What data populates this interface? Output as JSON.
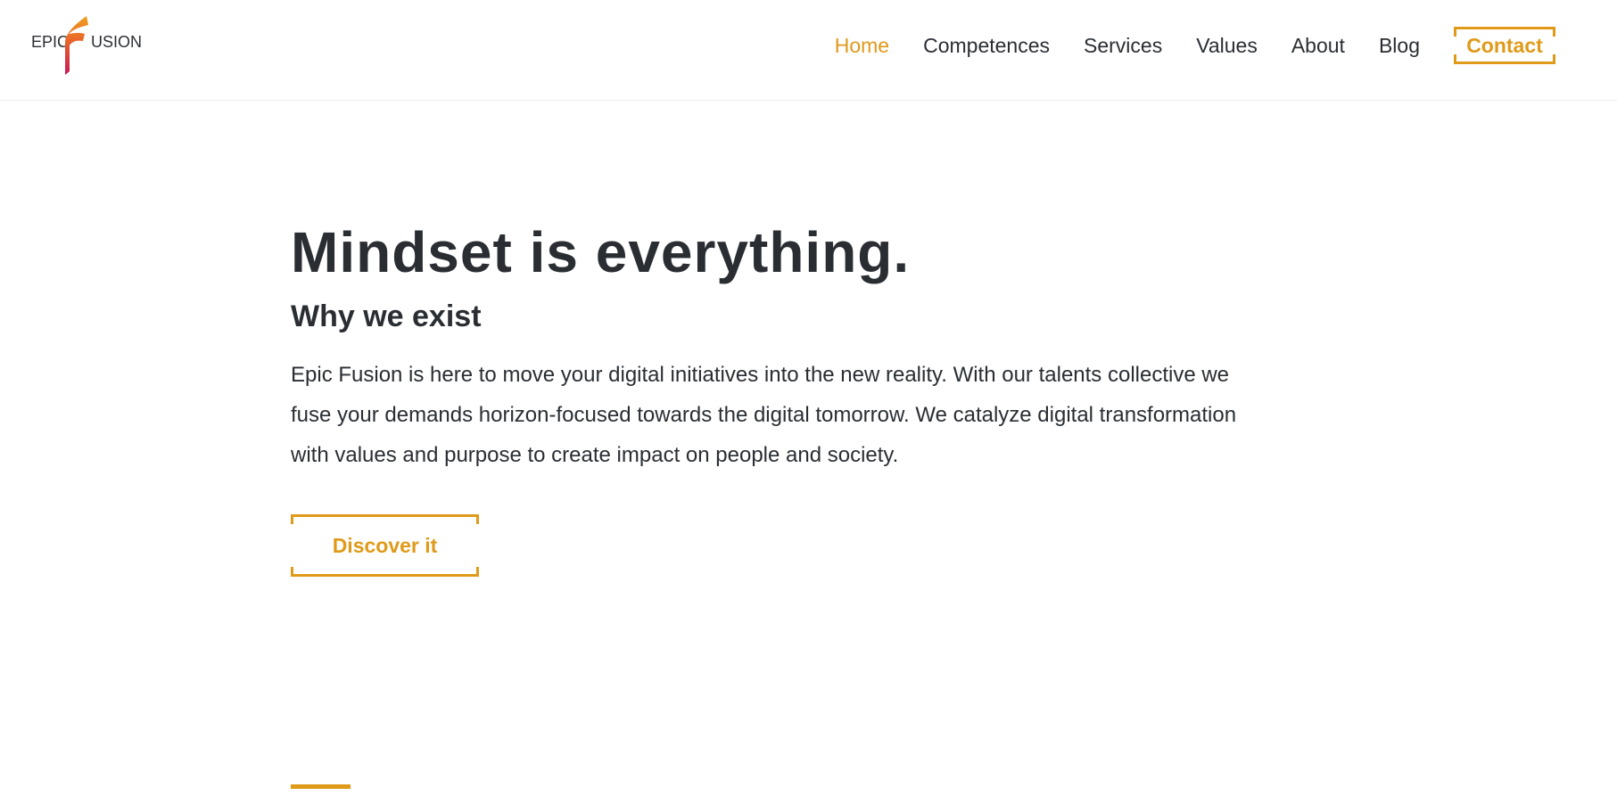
{
  "brand": {
    "logo_left": "EPIC",
    "logo_right": "USION",
    "accent_color": "#e09a1a",
    "text_color": "#2a2e33"
  },
  "nav": {
    "items": [
      {
        "label": "Home",
        "active": true
      },
      {
        "label": "Competences",
        "active": false
      },
      {
        "label": "Services",
        "active": false
      },
      {
        "label": "Values",
        "active": false
      },
      {
        "label": "About",
        "active": false
      },
      {
        "label": "Blog",
        "active": false
      }
    ],
    "contact_label": "Contact"
  },
  "hero": {
    "title": "Mindset is everything.",
    "subtitle": "Why we exist",
    "body": "Epic Fusion is here to move your digital initiatives into the new reality. With our talents collective we fuse your demands horizon-focused towards the digital tomorrow. We catalyze digital transformation with values and purpose to create impact on people and society.",
    "cta_label": "Discover it"
  }
}
